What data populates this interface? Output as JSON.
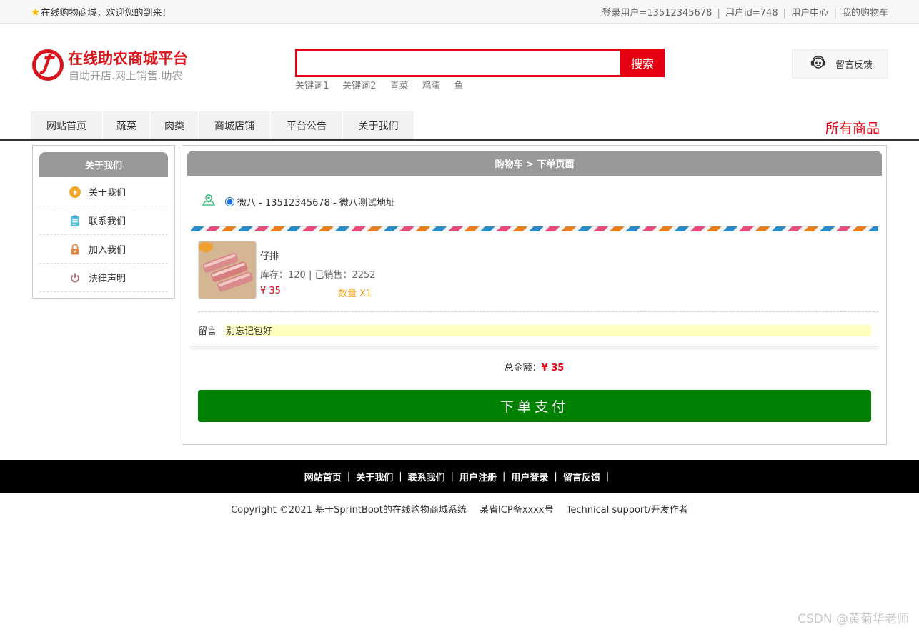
{
  "topbar": {
    "welcome": "在线购物商城，欢迎您的到来！",
    "user_label": "登录用户=13512345678",
    "userid_label": "用户id=748",
    "user_center": "用户中心",
    "my_cart": "我的购物车",
    "separator": "|"
  },
  "header": {
    "brand_title": "在线助农商城平台",
    "brand_sub": "自助开店.网上销售.助农",
    "search_value": "",
    "search_button": "搜索",
    "hotwords": [
      "关键词1",
      "关键词2",
      "青菜",
      "鸡蛋",
      "鱼"
    ],
    "feedback": "留言反馈"
  },
  "nav": {
    "items": [
      "网站首页",
      "蔬菜",
      "肉类",
      "商城店铺",
      "平台公告",
      "关于我们"
    ],
    "all_goods": "所有商品"
  },
  "sidebar": {
    "title": "关于我们",
    "items": [
      {
        "label": "关于我们",
        "icon": "about-icon"
      },
      {
        "label": "联系我们",
        "icon": "clipboard-icon"
      },
      {
        "label": "加入我们",
        "icon": "lock-icon"
      },
      {
        "label": "法律声明",
        "icon": "power-icon"
      }
    ]
  },
  "order": {
    "title": "购物车 > 下单页面",
    "address": "微八 - 13512345678 - 微八测试地址",
    "product": {
      "name": "仔排",
      "stock": "库存：120 | 已销售：2252",
      "price": "¥ 35",
      "qty": "数量 X1"
    },
    "remark_label": "留言",
    "remark_value": "别忘记包好",
    "total_label": "总金额：",
    "total_value": "¥ 35",
    "pay_button": "下单支付"
  },
  "footer": {
    "links": [
      "网站首页",
      "关于我们",
      "联系我们",
      "用户注册",
      "用户登录",
      "留言反馈"
    ],
    "separator": "|",
    "copyright": "Copyright ©2021 基于SprintBoot的在线购物商城系统",
    "icp": "某省ICP备xxxx号",
    "support": "Technical support/开发作者"
  },
  "watermark": "CSDN @黄菊华老师",
  "colors": {
    "accent_red": "#e60012",
    "pay_green": "#008000",
    "header_gray": "#999999"
  }
}
